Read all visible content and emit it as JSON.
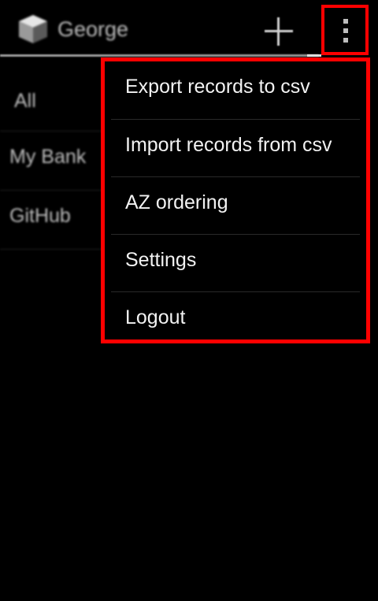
{
  "action_bar": {
    "account_name": "George",
    "add_icon": "plus-icon",
    "overflow_icon": "overflow-menu-icon"
  },
  "records": [
    {
      "label": "All"
    },
    {
      "label": "My Bank"
    },
    {
      "label": "GitHub"
    }
  ],
  "overflow_menu": {
    "items": [
      {
        "label": "Export records to csv"
      },
      {
        "label": "Import records from csv"
      },
      {
        "label": "AZ ordering"
      },
      {
        "label": "Settings"
      },
      {
        "label": "Logout"
      }
    ]
  },
  "colors": {
    "highlight": "#ff0000",
    "background": "#000000",
    "text": "#f2f2f2"
  }
}
